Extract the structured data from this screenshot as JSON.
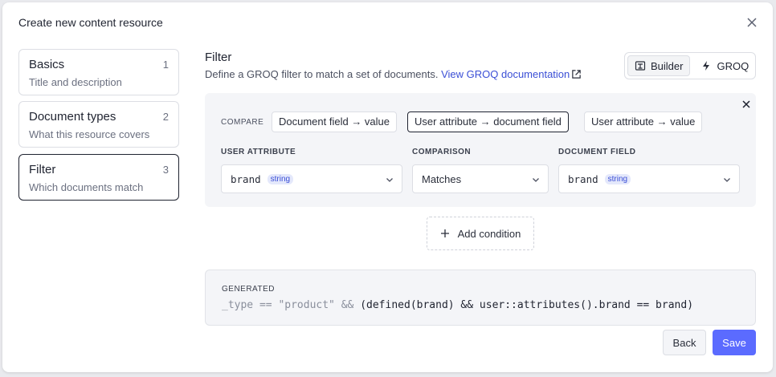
{
  "dialog": {
    "title": "Create new content resource"
  },
  "steps": [
    {
      "name": "Basics",
      "description": "Title and description",
      "number": "1",
      "active": false
    },
    {
      "name": "Document types",
      "description": "What this resource covers",
      "number": "2",
      "active": false
    },
    {
      "name": "Filter",
      "description": "Which documents match",
      "number": "3",
      "active": true
    }
  ],
  "filter": {
    "heading": "Filter",
    "description": "Define a GROQ filter to match a set of documents.",
    "doc_link": "View GROQ documentation",
    "modes": [
      {
        "label": "Builder",
        "icon": "builder-icon",
        "selected": true
      },
      {
        "label": "GROQ",
        "icon": "groq-icon",
        "selected": false
      }
    ]
  },
  "condition": {
    "compare_label": "COMPARE",
    "compare_options": [
      {
        "label": "Document field → value",
        "selected": false
      },
      {
        "label": "User attribute → document field",
        "selected": true
      },
      {
        "label": "User attribute → value",
        "selected": false
      }
    ],
    "user_attribute": {
      "label": "USER ATTRIBUTE",
      "value": "brand",
      "type": "string"
    },
    "comparison": {
      "label": "COMPARISON",
      "value": "Matches"
    },
    "document_field": {
      "label": "DOCUMENT FIELD",
      "value": "brand",
      "type": "string"
    }
  },
  "add_condition": {
    "label": "Add condition"
  },
  "generated": {
    "label": "GENERATED",
    "code_prefix": "_type == \"product\" &&",
    "code_main": "(defined(brand) && user::attributes().brand == brand)"
  },
  "actions": {
    "back": "Back",
    "save": "Save"
  },
  "colors": {
    "accent": "#5b6bff",
    "link": "#3b4fd6",
    "badge_bg": "#e4e8fb"
  }
}
